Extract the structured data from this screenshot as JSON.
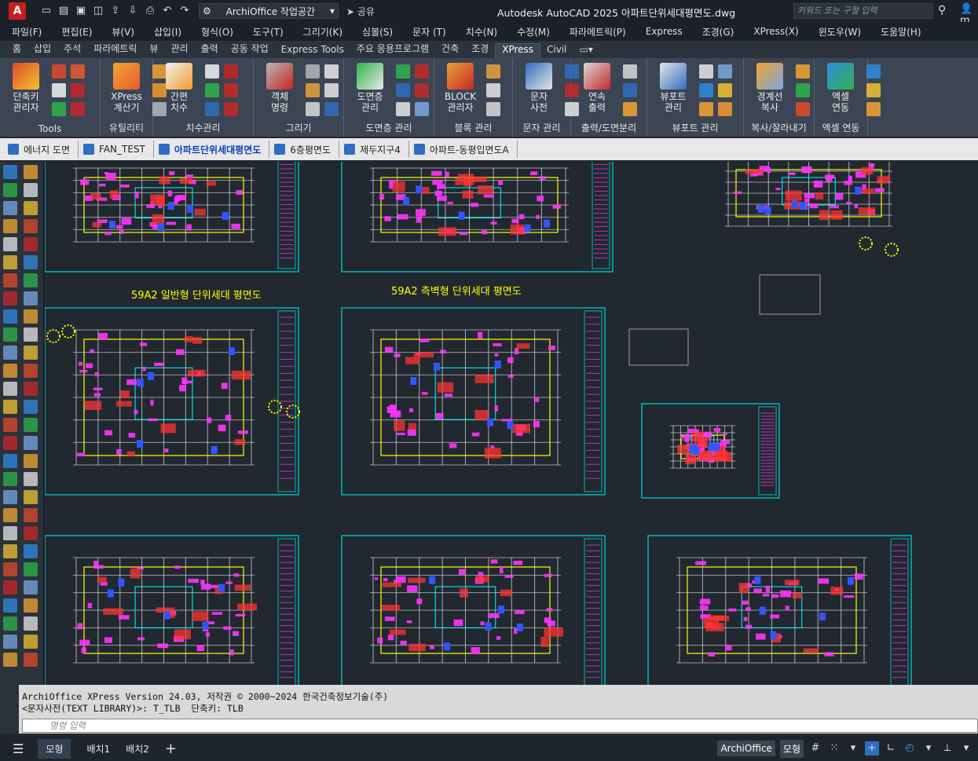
{
  "titlebar": {
    "app_logo": "A",
    "workspace": "ArchiOffice 작업공간",
    "share": "공유",
    "title": "Autodesk AutoCAD 2025    아파트단위세대평면도.dwg",
    "search_placeholder": "키워드 또는 구절 입력",
    "user": "m"
  },
  "menubar": {
    "items": [
      "파일(F)",
      "편집(E)",
      "뷰(V)",
      "삽입(I)",
      "형식(O)",
      "도구(T)",
      "그리기(K)",
      "심볼(S)",
      "문자 (T)",
      "치수(N)",
      "수정(M)",
      "파라메트릭(P)",
      "Express",
      "조경(G)",
      "XPress(X)",
      "윈도우(W)",
      "도움말(H)"
    ]
  },
  "ribbon_tabs": {
    "items": [
      "홈",
      "삽입",
      "주석",
      "파라메트릭",
      "뷰",
      "관리",
      "출력",
      "공동 작업",
      "Express Tools",
      "주요 응용프로그램",
      "건축",
      "조경",
      "XPress",
      "Civil"
    ],
    "active_index": 12
  },
  "ribbon_panels": [
    {
      "title": "Tools",
      "big": [
        "단축키\n관리자"
      ]
    },
    {
      "title": "유틸리티",
      "big": [
        "XPress\n계산기"
      ]
    },
    {
      "title": "치수관리",
      "big": [
        "간편\n치수"
      ]
    },
    {
      "title": "그리기",
      "big": [
        "객체\n명령"
      ]
    },
    {
      "title": "도면층 관리",
      "big": [
        "도면층\n관리"
      ]
    },
    {
      "title": "블록 관리",
      "big": [
        "BLOCK\n관리자"
      ]
    },
    {
      "title": "문자 관리",
      "big": [
        "문자\n사전"
      ]
    },
    {
      "title": "출력/도면분리",
      "big": [
        "연속\n출력"
      ]
    },
    {
      "title": "뷰포트 관리",
      "big": [
        "뷰포트\n관리"
      ]
    },
    {
      "title": "복사/잘라내기",
      "big": [
        "경계선\n복사"
      ]
    },
    {
      "title": "엑셀 연동",
      "big": [
        "엑셀\n연동"
      ]
    }
  ],
  "doc_tabs": {
    "items": [
      "에너지 도면",
      "FAN_TEST",
      "아파트단위세대평면도",
      "6층평면도",
      "제두지구4",
      "아파트-동평입면도A"
    ],
    "active_index": 2
  },
  "drawing": {
    "labels": [
      "59A2 일반형 단위세대 평면도",
      "59A2 측벽형 단위세대 평면도"
    ],
    "colors": {
      "background": "#212830",
      "frame": "#00b7b7",
      "wall": "#e6e6e6",
      "magenta": "#ff33ff",
      "yellow": "#ffff00",
      "cyan": "#00ffff",
      "red": "#ff3333",
      "blue": "#3355ff"
    }
  },
  "command": {
    "history": [
      "ArchiOffice XPress Version 24.03, 저작권 © 2000~2024 한국건축정보기술(주)",
      "<문자사전(TEXT LIBRARY)>: T_TLB  단축키: TLB"
    ],
    "input_placeholder": "명령 입력"
  },
  "statusbar": {
    "tabs": [
      "모형",
      "배치1",
      "배치2"
    ],
    "active_index": 0,
    "right_labels": [
      "ArchiOffice",
      "모형"
    ]
  }
}
